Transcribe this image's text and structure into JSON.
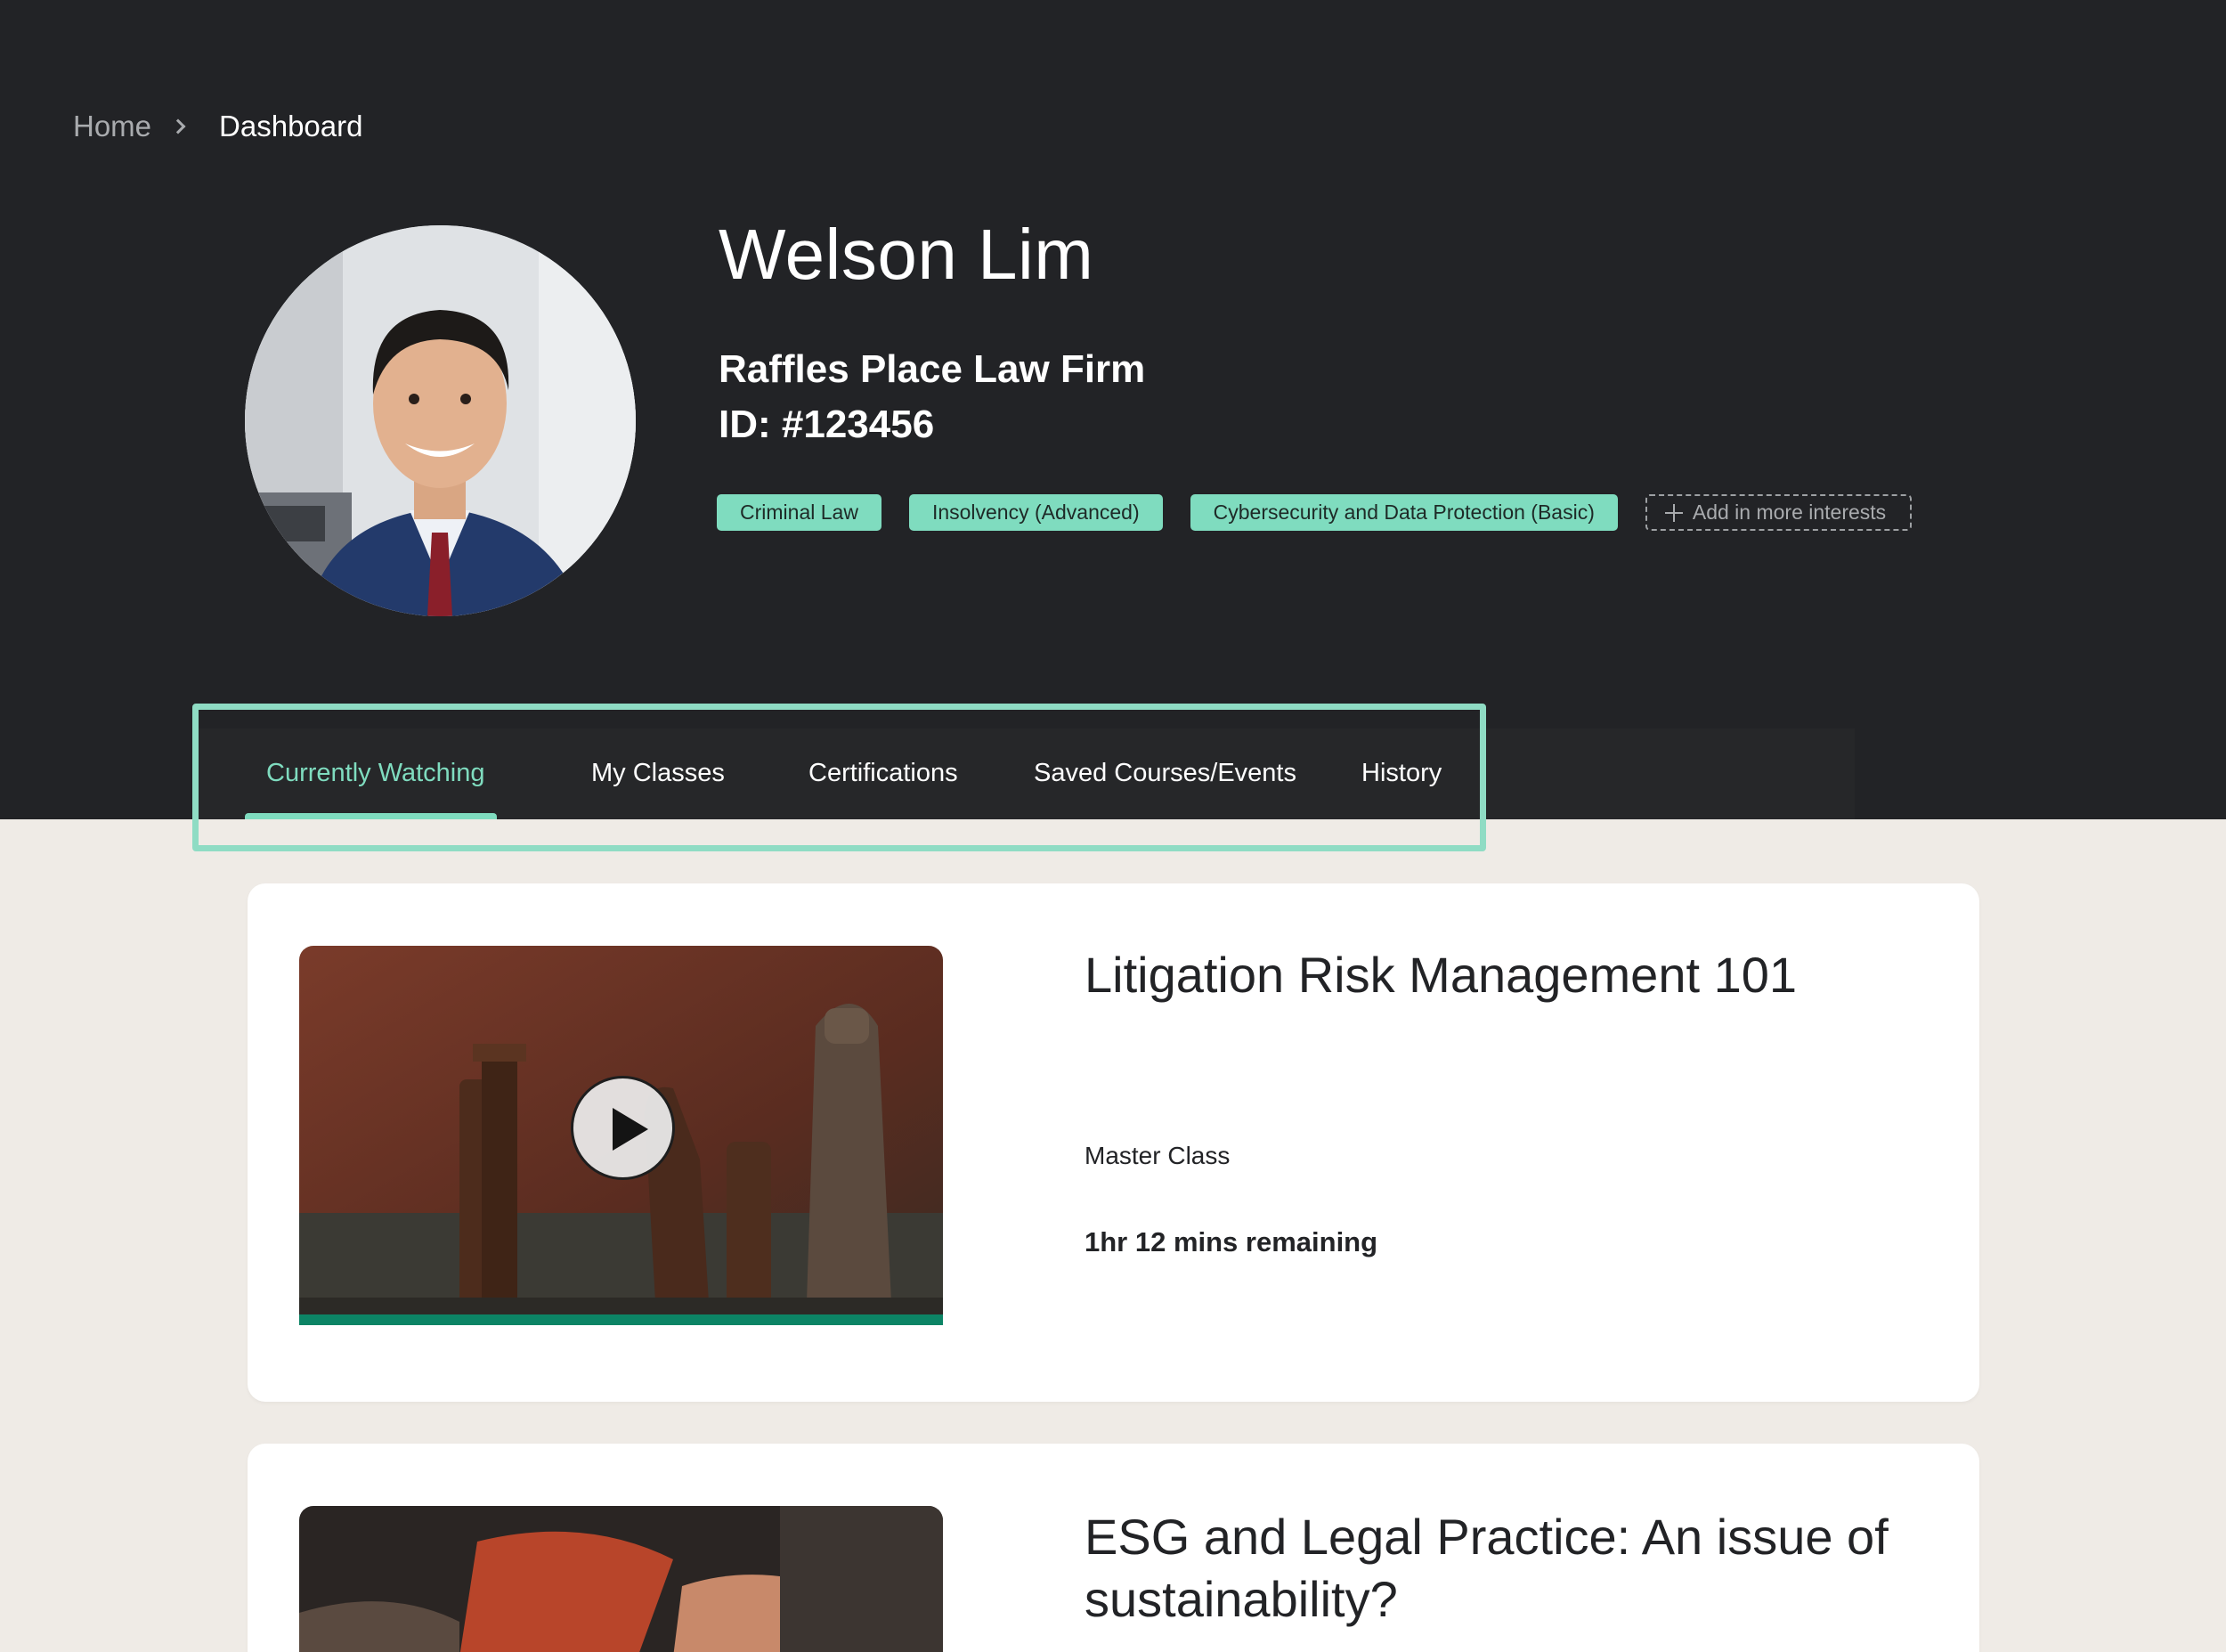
{
  "breadcrumb": {
    "home": "Home",
    "current": "Dashboard"
  },
  "profile": {
    "name": "Welson Lim",
    "firm": "Raffles Place Law Firm",
    "id": "ID: #123456",
    "tags": [
      "Criminal Law",
      "Insolvency (Advanced)",
      "Cybersecurity and Data Protection (Basic)"
    ],
    "add_interest_label": "Add in more interests"
  },
  "tabs": [
    {
      "label": "Currently Watching",
      "active": true
    },
    {
      "label": "My Classes",
      "active": false
    },
    {
      "label": "Certifications",
      "active": false
    },
    {
      "label": "Saved Courses/Events",
      "active": false
    },
    {
      "label": "History",
      "active": false
    }
  ],
  "courses": [
    {
      "title": "Litigation Risk Management 101",
      "type": "Master Class",
      "remaining": "1hr 12 mins remaining"
    },
    {
      "title": "ESG and Legal Practice: An issue of sustainability?"
    }
  ],
  "colors": {
    "hero_bg": "#222326",
    "page_bg": "#efebe6",
    "accent": "#7fdcbf",
    "progress": "#0c8465"
  }
}
